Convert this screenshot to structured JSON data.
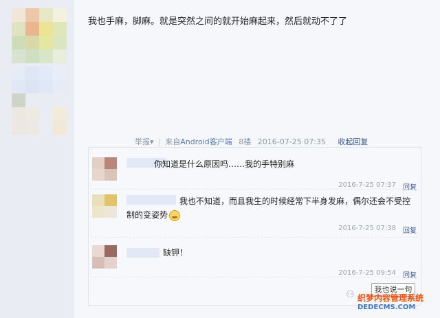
{
  "post": {
    "text": "我也手麻，脚麻。就是突然之间的就开始麻起来，然后就动不了了"
  },
  "meta": {
    "report": "举报",
    "report_arrow": "▾",
    "source_prefix": "来自",
    "source_link": "Android客户端",
    "floor": "8楼",
    "timestamp": "2016-07-25 07:35",
    "collapse_label": "收起回复"
  },
  "replies": [
    {
      "text": "你知道是什么原因吗……我的手特别麻",
      "time": "2016-7-25 07:37",
      "reply_label": "回复"
    },
    {
      "text_line1": "我也不知道，而且我生的时候经常下半身发麻，偶尔还会不受控",
      "text_line2": "制的变姿势",
      "time": "2016-7-25 07:38",
      "reply_label": "回复"
    },
    {
      "text": "缺钾！",
      "time": "2016-7-25 09:54",
      "reply_label": "回复"
    }
  ],
  "say_button": "我也说一句",
  "watermark": {
    "line1": "织梦内容管理系统",
    "line2": "DEDECMS.COM"
  }
}
